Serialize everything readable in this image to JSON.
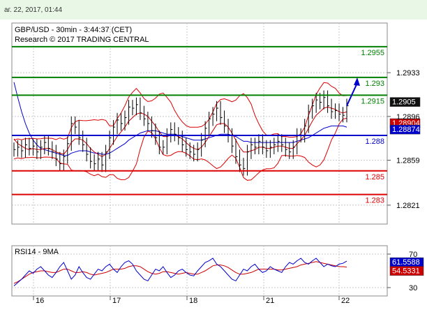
{
  "header": {
    "datetime": "аг. 22, 2017, 01:44"
  },
  "chart_data": {
    "type": "line",
    "title": "GBP/USD - 30min - 3:44:37 (CET)",
    "subtitle": "Research © 2017 TRADING CENTRAL",
    "x_ticks": [
      "16",
      "17",
      "18",
      "21",
      "22"
    ],
    "y_ticks": [
      1.2933,
      1.2896,
      1.2859,
      1.2821
    ],
    "ylim": [
      1.2805,
      1.2975
    ],
    "grid": true,
    "levels": [
      {
        "label": "1.2955",
        "value": 1.2955,
        "color": "#008000"
      },
      {
        "label": "1.293",
        "value": 1.2929,
        "color": "#008000"
      },
      {
        "label": "1.2915",
        "value": 1.2914,
        "color": "#008000"
      },
      {
        "label": "1.288",
        "value": 1.288,
        "color": "#0000cc"
      },
      {
        "label": "1.285",
        "value": 1.285,
        "color": "#dd0000"
      },
      {
        "label": "1.283",
        "value": 1.283,
        "color": "#dd0000"
      }
    ],
    "current_price": {
      "label": "1.2905",
      "value": 1.2905,
      "color": "#000000"
    },
    "ma_fast": {
      "label": "1.28904",
      "value": 1.289,
      "color": "#cc0000"
    },
    "ma_slow": {
      "label": "1.28874",
      "value": 1.2887,
      "color": "#0000cc"
    },
    "price_series": [
      1.2868,
      1.287,
      1.2867,
      1.2872,
      1.2869,
      1.2871,
      1.2866,
      1.287,
      1.2874,
      1.2869,
      1.2866,
      1.286,
      1.2856,
      1.2862,
      1.2873,
      1.289,
      1.2887,
      1.2878,
      1.2872,
      1.2864,
      1.2858,
      1.2856,
      1.286,
      1.2855,
      1.2866,
      1.2878,
      1.2887,
      1.2893,
      1.289,
      1.2895,
      1.2904,
      1.2903,
      1.2906,
      1.2899,
      1.2894,
      1.289,
      1.2884,
      1.2878,
      1.287,
      1.287,
      1.288,
      1.2885,
      1.2881,
      1.2878,
      1.2872,
      1.2868,
      1.2866,
      1.2864,
      1.2868,
      1.2876,
      1.2886,
      1.2894,
      1.2898,
      1.2903,
      1.2895,
      1.2888,
      1.288,
      1.2871,
      1.2862,
      1.2855,
      1.2852,
      1.2866,
      1.2872,
      1.287,
      1.2875,
      1.287,
      1.2867,
      1.287,
      1.2872,
      1.2875,
      1.2872,
      1.2868,
      1.2866,
      1.287,
      1.288,
      1.288,
      1.2888,
      1.29,
      1.2905,
      1.291,
      1.2908,
      1.2912,
      1.2905,
      1.29,
      1.2901,
      1.2898,
      1.2897,
      1.2905
    ],
    "ma_fast_series": [
      1.2877,
      1.2873,
      1.2871,
      1.2869,
      1.2868,
      1.2869,
      1.2868,
      1.2868,
      1.2869,
      1.2869,
      1.2868,
      1.2866,
      1.2865,
      1.2864,
      1.2868,
      1.2874,
      1.2877,
      1.2877,
      1.2876,
      1.2873,
      1.2869,
      1.2866,
      1.2864,
      1.2862,
      1.2864,
      1.2869,
      1.2874,
      1.2879,
      1.2883,
      1.2887,
      1.2892,
      1.2895,
      1.2898,
      1.2899,
      1.2898,
      1.2896,
      1.2892,
      1.2888,
      1.2883,
      1.2879,
      1.2879,
      1.288,
      1.288,
      1.2879,
      1.2877,
      1.2874,
      1.2871,
      1.2869,
      1.2868,
      1.287,
      1.2874,
      1.2879,
      1.2884,
      1.2889,
      1.289,
      1.289,
      1.2887,
      1.2882,
      1.2876,
      1.287,
      1.2866,
      1.2866,
      1.2867,
      1.2868,
      1.287,
      1.287,
      1.2869,
      1.2869,
      1.287,
      1.2871,
      1.2871,
      1.287,
      1.2869,
      1.2869,
      1.2873,
      1.2876,
      1.288,
      1.2886,
      1.2892,
      1.2897,
      1.29,
      1.2903,
      1.2904,
      1.2903,
      1.2902,
      1.29,
      1.2899,
      1.29
    ],
    "ma_slow_series": [
      1.2925,
      1.2912,
      1.29,
      1.289,
      1.2882,
      1.2876,
      1.2872,
      1.2869,
      1.2868,
      1.2867,
      1.2866,
      1.2865,
      1.2864,
      1.2863,
      1.2863,
      1.2865,
      1.2866,
      1.2867,
      1.2867,
      1.2867,
      1.2866,
      1.2865,
      1.2865,
      1.2864,
      1.2864,
      1.2865,
      1.2867,
      1.2869,
      1.2871,
      1.2873,
      1.2876,
      1.2878,
      1.288,
      1.2882,
      1.2883,
      1.2884,
      1.2884,
      1.2884,
      1.2883,
      1.2882,
      1.2881,
      1.2881,
      1.2881,
      1.288,
      1.2879,
      1.2878,
      1.2877,
      1.2876,
      1.2876,
      1.2876,
      1.2877,
      1.2878,
      1.2879,
      1.288,
      1.2881,
      1.2881,
      1.2881,
      1.288,
      1.2879,
      1.2877,
      1.2875,
      1.2875,
      1.2874,
      1.2874,
      1.2874,
      1.2874,
      1.2874,
      1.2874,
      1.2874,
      1.2874,
      1.2874,
      1.2874,
      1.2874,
      1.2874,
      1.2875,
      1.2876,
      1.2877,
      1.2878,
      1.288,
      1.2882,
      1.2884,
      1.2886,
      1.2887,
      1.2888,
      1.2888,
      1.2888,
      1.2888,
      1.2887
    ],
    "projection": {
      "from": 1.2905,
      "to": 1.2929
    },
    "rsi": {
      "title": "RSI14 - 9MA",
      "y_ticks": [
        70,
        30
      ],
      "ylim": [
        20,
        80
      ],
      "rsi_label": "61.5588",
      "rsi_value": 61.5588,
      "ma_label": "54.5331",
      "ma_value": 54.5331,
      "rsi_series": [
        32,
        36,
        40,
        45,
        50,
        47,
        52,
        55,
        50,
        45,
        42,
        48,
        55,
        60,
        50,
        40,
        45,
        55,
        48,
        42,
        40,
        46,
        52,
        50,
        55,
        58,
        52,
        48,
        55,
        60,
        62,
        58,
        50,
        45,
        40,
        38,
        45,
        52,
        50,
        55,
        48,
        42,
        45,
        50,
        52,
        48,
        45,
        44,
        50,
        55,
        60,
        62,
        65,
        58,
        55,
        50,
        45,
        40,
        38,
        45,
        52,
        50,
        55,
        58,
        52,
        48,
        50,
        55,
        52,
        50,
        48,
        55,
        60,
        58,
        62,
        65,
        60,
        58,
        62,
        65,
        60,
        55,
        58,
        56,
        55,
        58,
        59,
        61.5588
      ],
      "ma_series": [
        35,
        37,
        40,
        43,
        46,
        48,
        49,
        50,
        50,
        49,
        48,
        48,
        50,
        52,
        52,
        50,
        48,
        48,
        49,
        48,
        46,
        45,
        46,
        47,
        48,
        50,
        52,
        52,
        52,
        53,
        55,
        56,
        56,
        55,
        52,
        49,
        47,
        46,
        47,
        49,
        49,
        48,
        47,
        46,
        47,
        48,
        47,
        46,
        46,
        48,
        50,
        53,
        56,
        57,
        57,
        56,
        54,
        51,
        48,
        46,
        46,
        47,
        48,
        50,
        52,
        52,
        52,
        52,
        52,
        51,
        51,
        52,
        53,
        54,
        55,
        57,
        58,
        59,
        60,
        61,
        60,
        59,
        58,
        57,
        56,
        55,
        55,
        54.5331
      ]
    },
    "colors": {
      "grid": "#c8c8c8",
      "bollinger": "#dd0000",
      "price": "#000000",
      "ma_fast": "#cc0000",
      "ma_slow": "#0000cc",
      "arrow": "#0000cc"
    }
  }
}
